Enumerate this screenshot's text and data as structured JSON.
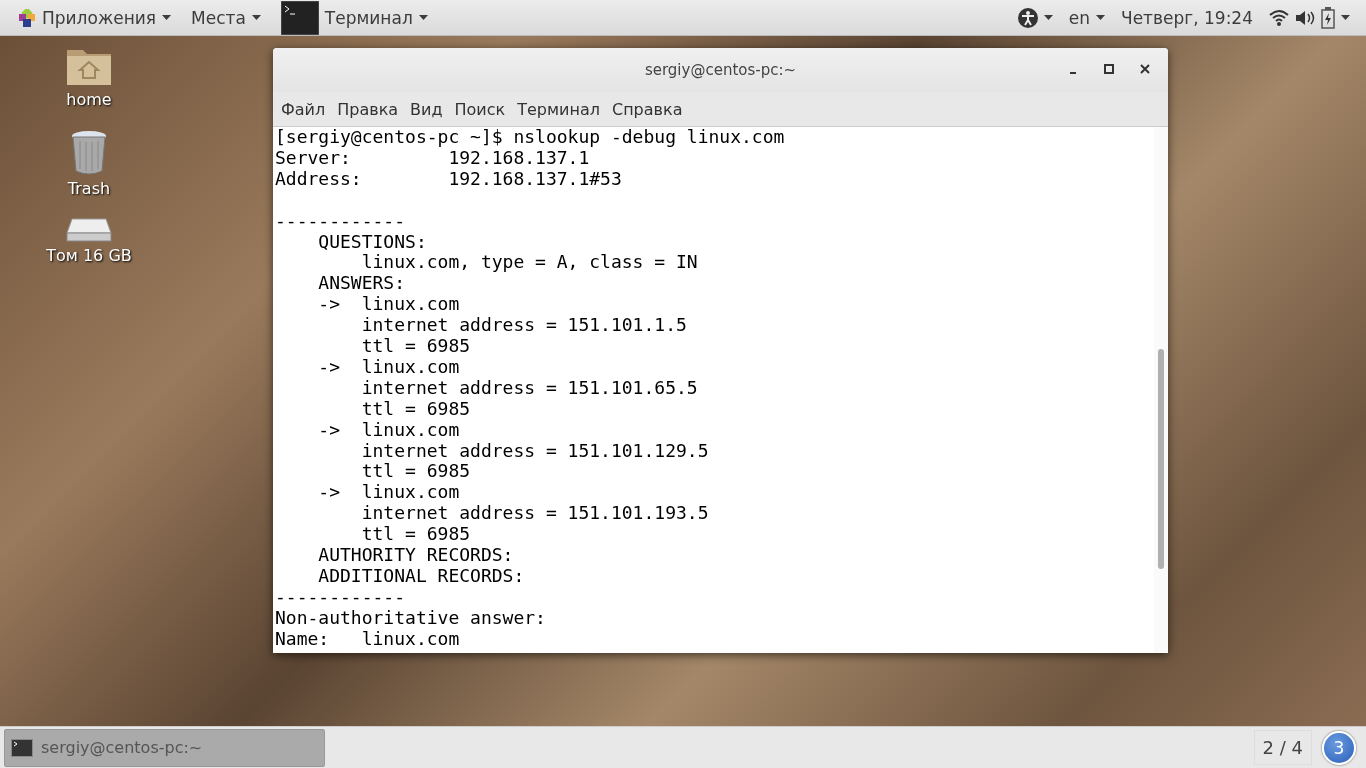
{
  "top_bar": {
    "menus": [
      {
        "label": "Приложения",
        "kind": "apps"
      },
      {
        "label": "Места",
        "kind": "plain"
      },
      {
        "label": "Терминал",
        "kind": "app"
      }
    ],
    "language": "en",
    "clock": "Четверг, 19:24"
  },
  "desktop_icons": [
    {
      "label": "home",
      "kind": "folder"
    },
    {
      "label": "Trash",
      "kind": "trash"
    },
    {
      "label": "Том 16 GB",
      "kind": "drive"
    }
  ],
  "window": {
    "title": "sergiy@centos-pc:~",
    "menu": [
      "Файл",
      "Правка",
      "Вид",
      "Поиск",
      "Терминал",
      "Справка"
    ],
    "terminal_blocks": [
      [
        "[sergiy@centos-pc ~]$ nslookup -debug linux.com",
        "Server:         192.168.137.1",
        "Address:        192.168.137.1#53"
      ],
      [
        "------------",
        "    QUESTIONS:",
        "        linux.com, type = A, class = IN",
        "    ANSWERS:",
        "    ->  linux.com",
        "        internet address = 151.101.1.5",
        "        ttl = 6985",
        "    ->  linux.com",
        "        internet address = 151.101.65.5",
        "        ttl = 6985",
        "    ->  linux.com",
        "        internet address = 151.101.129.5",
        "        ttl = 6985",
        "    ->  linux.com",
        "        internet address = 151.101.193.5",
        "        ttl = 6985",
        "    AUTHORITY RECORDS:",
        "    ADDITIONAL RECORDS:",
        "------------",
        "Non-authoritative answer:",
        "Name:   linux.com"
      ]
    ]
  },
  "taskbar": {
    "tasks": [
      {
        "label": "sergiy@centos-pc:~",
        "selected": true
      }
    ],
    "workspace": "2 / 4",
    "notification_count": "3"
  }
}
